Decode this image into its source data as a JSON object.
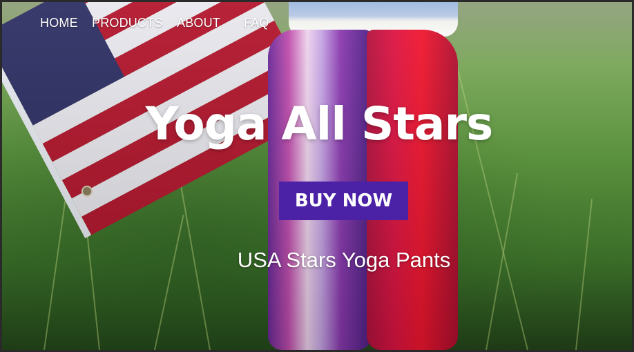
{
  "nav": {
    "items": [
      {
        "label": "HOME"
      },
      {
        "label": "PRODUCTS"
      },
      {
        "label": "ABOUT"
      },
      {
        "label": "FAQ"
      }
    ]
  },
  "hero": {
    "title": "Yoga All Stars",
    "cta_label": "BUY NOW",
    "subtitle": "USA Stars Yoga Pants"
  },
  "colors": {
    "cta_background": "#4b22a6",
    "text": "#ffffff",
    "page_frame": "#2a2a2a"
  }
}
